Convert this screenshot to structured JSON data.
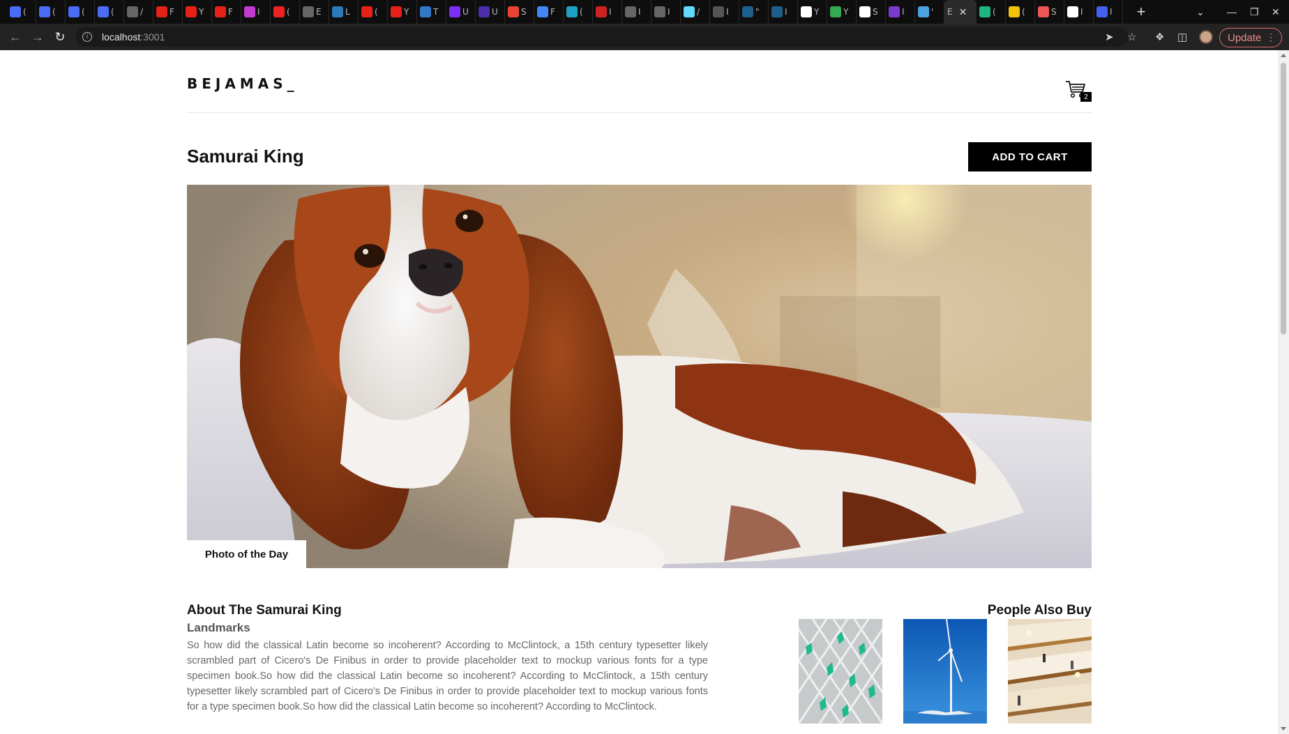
{
  "browser": {
    "tabs": [
      {
        "favicon": "translate-icon",
        "color": "#4a6cf7",
        "letter": "("
      },
      {
        "favicon": "translate-icon",
        "color": "#4a6cf7",
        "letter": "("
      },
      {
        "favicon": "translate-icon",
        "color": "#4a6cf7",
        "letter": "("
      },
      {
        "favicon": "translate-icon",
        "color": "#4a6cf7",
        "letter": "("
      },
      {
        "favicon": "globe-icon",
        "color": "#666",
        "letter": "/"
      },
      {
        "favicon": "youtube-icon",
        "color": "#e62117",
        "letter": "F"
      },
      {
        "favicon": "youtube-icon",
        "color": "#e62117",
        "letter": "Y"
      },
      {
        "favicon": "youtube-icon",
        "color": "#e62117",
        "letter": "F"
      },
      {
        "favicon": "purple-app-icon",
        "color": "#c23ad1",
        "letter": "I"
      },
      {
        "favicon": "red-circle-icon",
        "color": "#e22",
        "letter": "("
      },
      {
        "favicon": "globe-icon",
        "color": "#666",
        "letter": "E"
      },
      {
        "favicon": "l-app-icon",
        "color": "#2a7ab8",
        "letter": "L"
      },
      {
        "favicon": "youtube-icon",
        "color": "#e62117",
        "letter": "("
      },
      {
        "favicon": "youtube-icon",
        "color": "#e62117",
        "letter": "Y"
      },
      {
        "favicon": "ts-icon",
        "color": "#3178c6",
        "letter": "T"
      },
      {
        "favicon": "a-app-icon",
        "color": "#7b2ff7",
        "letter": "U"
      },
      {
        "favicon": "apollo-icon",
        "color": "#4b2ea8",
        "letter": "U"
      },
      {
        "favicon": "gmail-icon",
        "color": "#ea4335",
        "letter": "S"
      },
      {
        "favicon": "docs-icon",
        "color": "#4285f4",
        "letter": "F"
      },
      {
        "favicon": "b-app-icon",
        "color": "#1da1c4",
        "letter": "("
      },
      {
        "favicon": "pdf-icon",
        "color": "#c22",
        "letter": "I"
      },
      {
        "favicon": "globe-icon",
        "color": "#666",
        "letter": "I"
      },
      {
        "favicon": "globe-icon",
        "color": "#666",
        "letter": "I"
      },
      {
        "favicon": "react-icon",
        "color": "#61dafb",
        "letter": "/"
      },
      {
        "favicon": "github-icon",
        "color": "#555",
        "letter": "I"
      },
      {
        "favicon": "t-app-icon",
        "color": "#1d5f8a",
        "letter": "\""
      },
      {
        "favicon": "t-app-icon",
        "color": "#1d5f8a",
        "letter": "I"
      },
      {
        "favicon": "google-icon",
        "color": "#fff",
        "letter": "Y"
      },
      {
        "favicon": "maps-icon",
        "color": "#34a853",
        "letter": "Y"
      },
      {
        "favicon": "google-icon",
        "color": "#fff",
        "letter": "S"
      },
      {
        "favicon": "dots-app-icon",
        "color": "#7a3bd1",
        "letter": "I"
      },
      {
        "favicon": "globe-color-icon",
        "color": "#4aa3df",
        "letter": "'"
      },
      {
        "active": true,
        "favicon": "",
        "letter": "E"
      },
      {
        "favicon": "wifi-icon",
        "color": "#1db584",
        "letter": "("
      },
      {
        "favicon": "yellow-app-icon",
        "color": "#f4c20d",
        "letter": "("
      },
      {
        "favicon": "s-app-icon",
        "color": "#e55",
        "letter": "S"
      },
      {
        "favicon": "triangle-icon",
        "color": "#fff",
        "letter": "I"
      },
      {
        "favicon": "bar-app-icon",
        "color": "#4361ee",
        "letter": "I"
      }
    ],
    "url_host": "localhost",
    "url_port": ":3001",
    "update_label": "Update"
  },
  "site": {
    "logo": "BEJAMAS_",
    "cart_count": "2"
  },
  "product": {
    "title": "Samurai King",
    "add_to_cart": "ADD TO CART",
    "hero_tag": "Photo of the Day",
    "hero_alt": "photo-of-the-day"
  },
  "about": {
    "heading": "About The Samurai King",
    "category": "Landmarks",
    "body": "So how did the classical Latin become so incoherent? According to McClintock, a 15th century typesetter likely scrambled part of Cicero's De Finibus in order to provide placeholder text to mockup various fonts for a type specimen book.So how did the classical Latin become so incoherent? According to McClintock, a 15th century typesetter likely scrambled part of Cicero's De Finibus in order to provide placeholder text to mockup various fonts for a type specimen book.So how did the classical Latin become so incoherent? According to McClintock."
  },
  "also_buy": {
    "heading": "People Also Buy",
    "items": [
      {
        "name": "architecture-photo"
      },
      {
        "name": "wind-turbine-photo"
      },
      {
        "name": "escalators-photo"
      }
    ]
  }
}
